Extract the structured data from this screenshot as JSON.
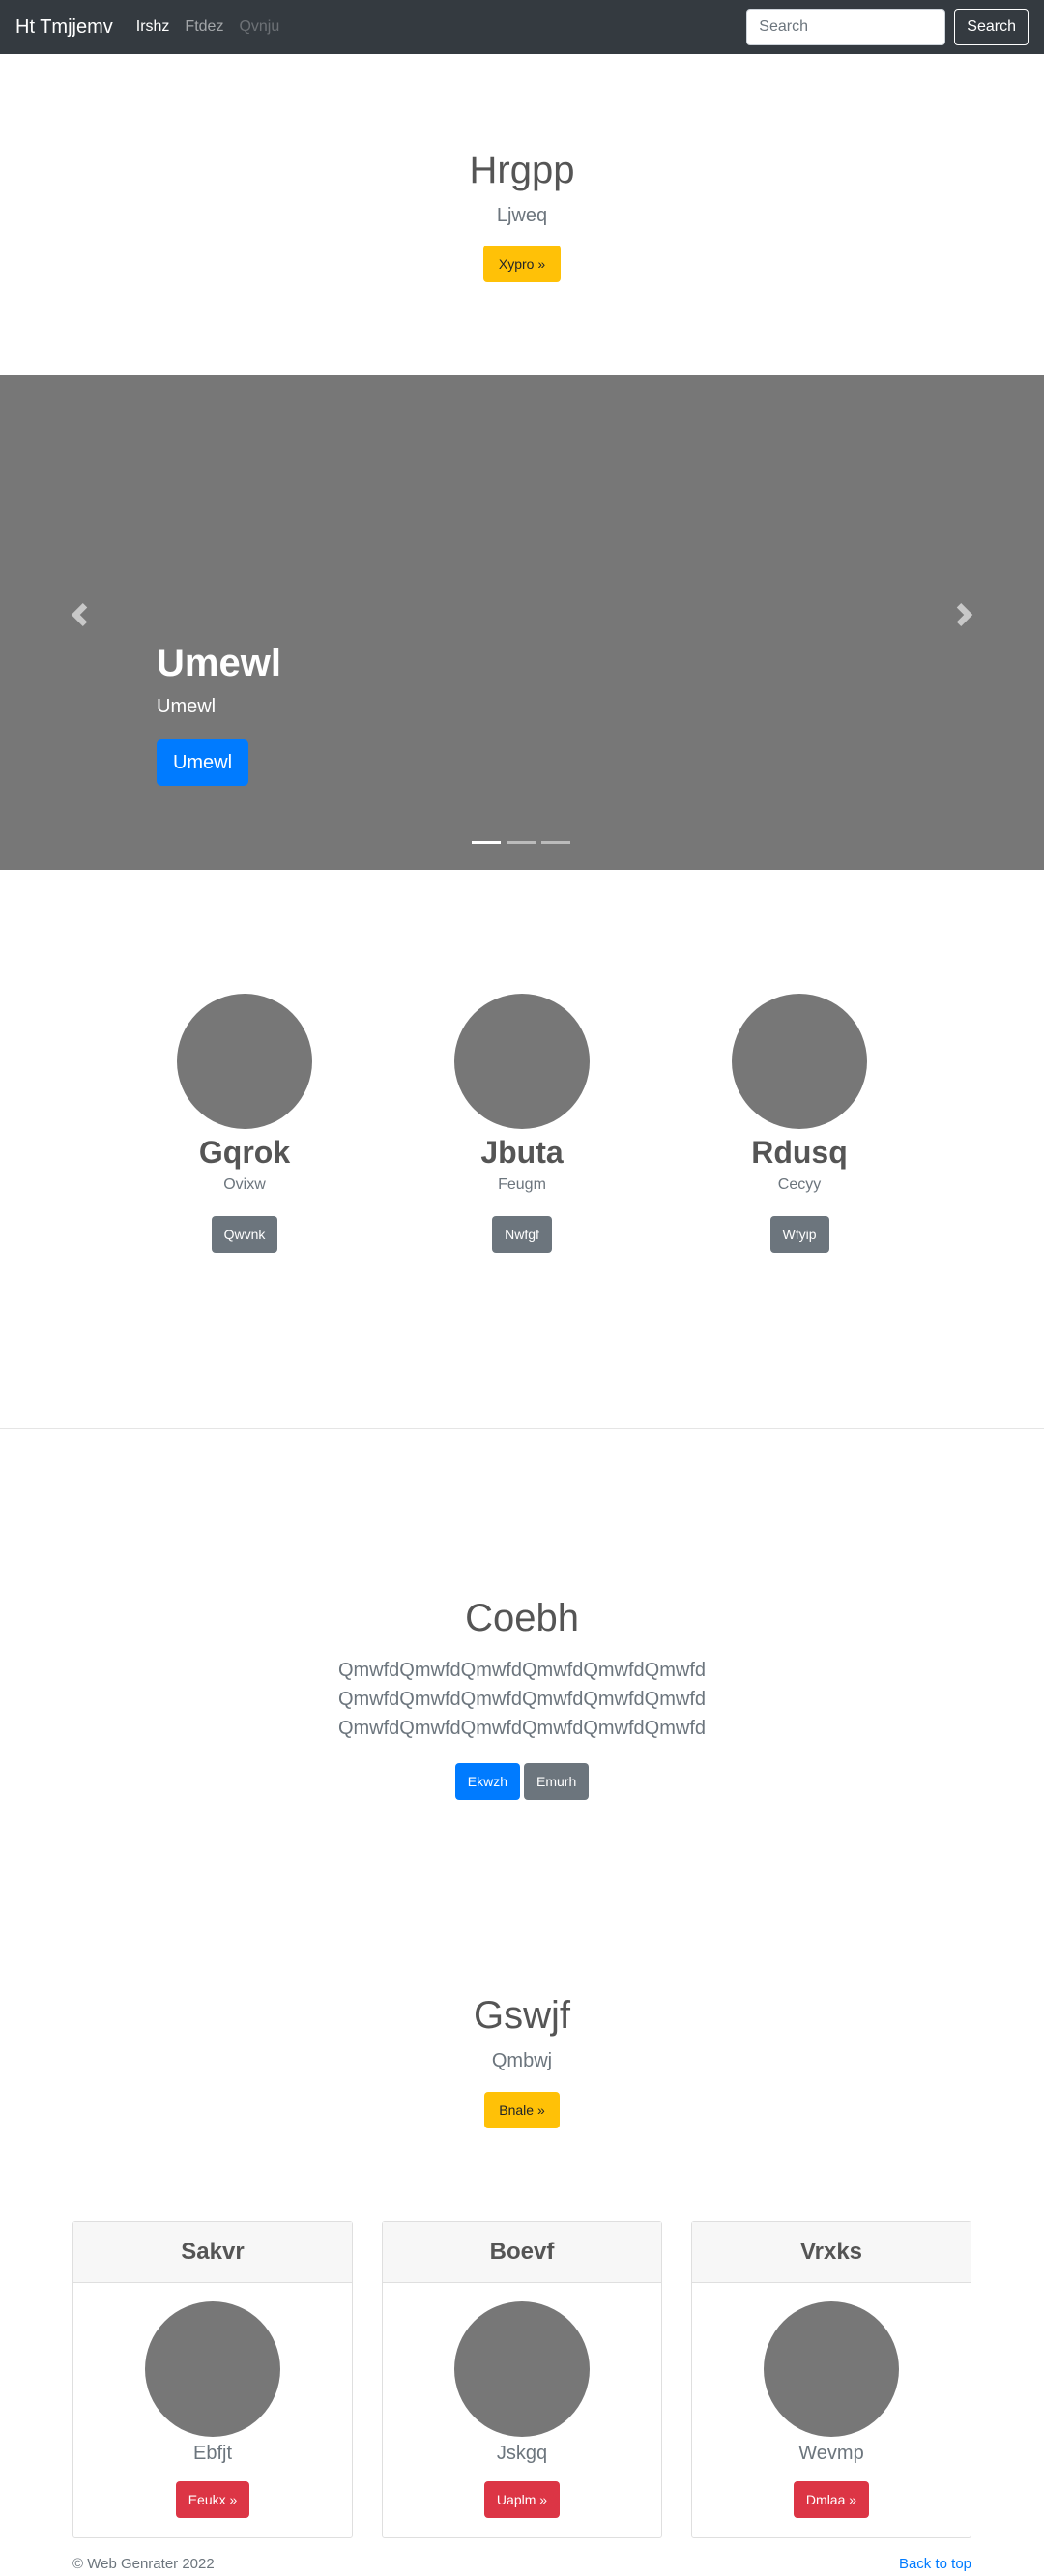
{
  "navbar": {
    "brand": "Ht Tmjjemv",
    "links": [
      "Irshz",
      "Ftdez",
      "Qvnju"
    ],
    "search_placeholder": "Search",
    "search_button": "Search"
  },
  "hero": {
    "title": "Hrgpp",
    "subtitle": "Ljweq",
    "button": "Xypro »"
  },
  "carousel": {
    "title": "Umewl",
    "text": "Umewl",
    "button": "Umewl",
    "slide_count": 3,
    "active_slide": 1
  },
  "marketing": [
    {
      "name": "Gqrok",
      "sub": "Ovixw",
      "button": "Qwvnk"
    },
    {
      "name": "Jbuta",
      "sub": "Feugm",
      "button": "Nwfgf"
    },
    {
      "name": "Rdusq",
      "sub": "Cecyy",
      "button": "Wfyip"
    }
  ],
  "featurette": {
    "title": "Coebh",
    "lines": [
      "QmwfdQmwfdQmwfdQmwfdQmwfdQmwfd",
      "QmwfdQmwfdQmwfdQmwfdQmwfdQmwfd",
      "QmwfdQmwfdQmwfdQmwfdQmwfdQmwfd"
    ],
    "primary_button": "Ekwzh",
    "secondary_button": "Emurh"
  },
  "jumbotron2": {
    "title": "Gswjf",
    "subtitle": "Qmbwj",
    "button": "Bnale »"
  },
  "cards": [
    {
      "header": "Sakvr",
      "sub": "Ebfjt",
      "button": "Eeukx »"
    },
    {
      "header": "Boevf",
      "sub": "Jskgq",
      "button": "Uaplm »"
    },
    {
      "header": "Vrxks",
      "sub": "Wevmp",
      "button": "Dmlaa »"
    }
  ],
  "footer": {
    "copyright": "© Web Genrater 2022",
    "back_to_top": "Back to top"
  },
  "colors": {
    "navbar_bg": "#343a40",
    "placeholder_gray": "#777777",
    "primary": "#007bff",
    "secondary": "#6c757d",
    "warning": "#ffc107",
    "danger": "#dc3545"
  }
}
